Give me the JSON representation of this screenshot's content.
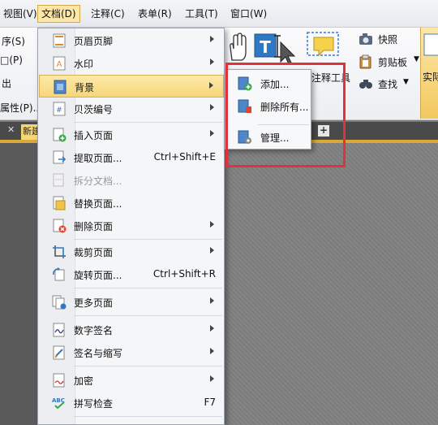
{
  "menubar": {
    "items": [
      {
        "label": "视图(V)"
      },
      {
        "label": "文档(D)"
      },
      {
        "label": "注释(C)"
      },
      {
        "label": "表单(R)"
      },
      {
        "label": "工具(T)"
      },
      {
        "label": "窗口(W)"
      }
    ]
  },
  "ribbon": {
    "left_labels": [
      "序(S)",
      "□(P)",
      "出",
      "属性(P)..."
    ],
    "annot_tool_label": "注释工具",
    "snapshot_label": "快照",
    "clipboard_label": "剪贴板",
    "find_label": "查找",
    "actual_size_label": "实际"
  },
  "tabs": {
    "doc_tab": "新建",
    "close_glyph": "✕",
    "add_glyph": "+"
  },
  "menu": {
    "items": [
      {
        "label": "页眉页脚",
        "has_submenu": true
      },
      {
        "label": "水印",
        "has_submenu": true
      },
      {
        "label": "背景",
        "has_submenu": true
      },
      {
        "label": "贝茨编号",
        "has_submenu": true
      },
      {
        "label": "插入页面",
        "has_submenu": true
      },
      {
        "label": "提取页面...",
        "shortcut": "Ctrl+Shift+E"
      },
      {
        "label": "拆分文档..."
      },
      {
        "label": "替换页面..."
      },
      {
        "label": "删除页面",
        "has_submenu": true
      },
      {
        "label": "裁剪页面",
        "has_submenu": true
      },
      {
        "label": "旋转页面...",
        "shortcut": "Ctrl+Shift+R"
      },
      {
        "label": "更多页面",
        "has_submenu": true
      },
      {
        "label": "数字签名",
        "has_submenu": true
      },
      {
        "label": "签名与缩写",
        "has_submenu": true
      },
      {
        "label": "加密",
        "has_submenu": true
      },
      {
        "label": "拼写检查",
        "shortcut": "F7"
      }
    ]
  },
  "submenu": {
    "items": [
      {
        "label": "添加..."
      },
      {
        "label": "删除所有..."
      },
      {
        "label": "管理..."
      }
    ]
  }
}
